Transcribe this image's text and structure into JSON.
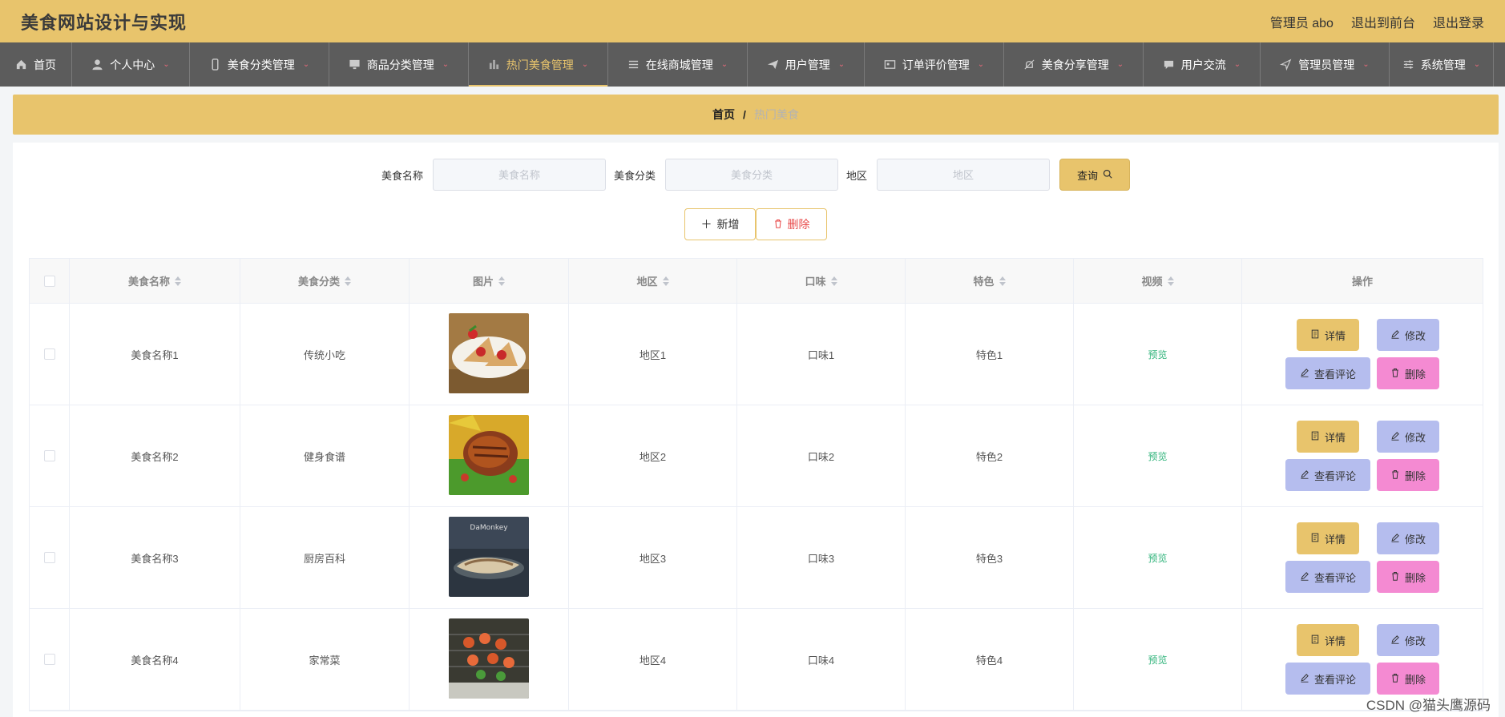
{
  "header": {
    "title": "美食网站设计与实现",
    "admin": "管理员 abo",
    "to_front": "退出到前台",
    "logout": "退出登录"
  },
  "nav": [
    {
      "label": "首页",
      "icon": "home-icon",
      "dropdown": false,
      "active": false
    },
    {
      "label": "个人中心",
      "icon": "user-icon",
      "dropdown": true,
      "active": false
    },
    {
      "label": "美食分类管理",
      "icon": "phone-icon",
      "dropdown": true,
      "active": false
    },
    {
      "label": "商品分类管理",
      "icon": "monitor-icon",
      "dropdown": true,
      "active": false
    },
    {
      "label": "热门美食管理",
      "icon": "chart-icon",
      "dropdown": true,
      "active": true
    },
    {
      "label": "在线商城管理",
      "icon": "list-icon",
      "dropdown": true,
      "active": false
    },
    {
      "label": "用户管理",
      "icon": "send-icon",
      "dropdown": true,
      "active": false
    },
    {
      "label": "订单评价管理",
      "icon": "card-icon",
      "dropdown": true,
      "active": false
    },
    {
      "label": "美食分享管理",
      "icon": "bell-icon",
      "dropdown": true,
      "active": false
    },
    {
      "label": "用户交流",
      "icon": "chat-icon",
      "dropdown": true,
      "active": false
    },
    {
      "label": "管理员管理",
      "icon": "navigation-icon",
      "dropdown": true,
      "active": false
    },
    {
      "label": "系统管理",
      "icon": "sliders-icon",
      "dropdown": true,
      "active": false
    }
  ],
  "breadcrumb": {
    "home": "首页",
    "sep": "/",
    "current": "热门美食"
  },
  "search": {
    "name_label": "美食名称",
    "name_placeholder": "美食名称",
    "category_label": "美食分类",
    "category_placeholder": "美食分类",
    "region_label": "地区",
    "region_placeholder": "地区",
    "query_label": "查询"
  },
  "actions": {
    "add_label": "新增",
    "delete_label": "删除"
  },
  "table": {
    "columns": [
      "美食名称",
      "美食分类",
      "图片",
      "地区",
      "口味",
      "特色",
      "视频",
      "操作"
    ],
    "rows": [
      {
        "name": "美食名称1",
        "category": "传统小吃",
        "region": "地区1",
        "taste": "口味1",
        "feature": "特色1",
        "video": "预览"
      },
      {
        "name": "美食名称2",
        "category": "健身食谱",
        "region": "地区2",
        "taste": "口味2",
        "feature": "特色2",
        "video": "预览"
      },
      {
        "name": "美食名称3",
        "category": "厨房百科",
        "region": "地区3",
        "taste": "口味3",
        "feature": "特色3",
        "video": "预览"
      },
      {
        "name": "美食名称4",
        "category": "家常菜",
        "region": "地区4",
        "taste": "口味4",
        "feature": "特色4",
        "video": "预览"
      }
    ],
    "op_labels": {
      "detail": "详情",
      "edit": "修改",
      "review": "查看评论",
      "delete": "删除"
    }
  },
  "watermark": "CSDN @猫头鹰源码",
  "colors": {
    "accent": "#e8c46c",
    "nav_bg": "#5c5c5c",
    "edit_btn": "#b5bdee",
    "delete_btn": "#f48ad2",
    "preview_link": "#2fb37a"
  }
}
